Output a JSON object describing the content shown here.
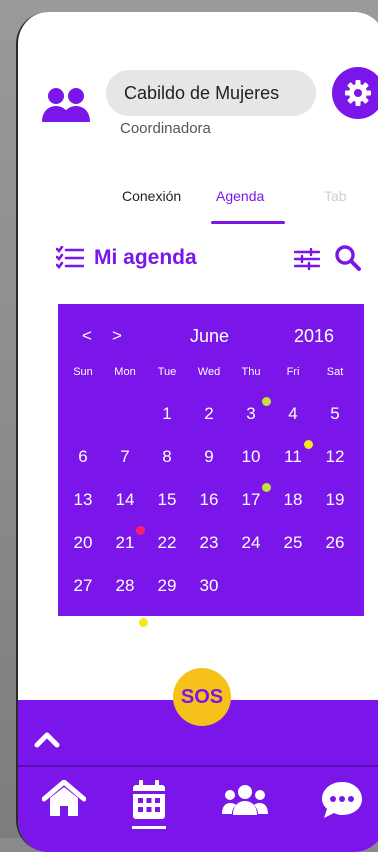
{
  "user": {
    "name": "Cabildo de Mujeres",
    "role": "Coordinadora"
  },
  "tabs": [
    {
      "label": "Conexión",
      "active": false
    },
    {
      "label": "Agenda",
      "active": true
    },
    {
      "label": "Tab",
      "active": false
    }
  ],
  "agenda": {
    "title": "Mi agenda"
  },
  "calendar": {
    "prev": "<",
    "next": ">",
    "month": "June",
    "year": "2016",
    "weekdays": [
      "Sun",
      "Mon",
      "Tue",
      "Wed",
      "Thu",
      "Fri",
      "Sat"
    ],
    "weeks": [
      [
        "",
        "",
        "1",
        "2",
        "3",
        "4",
        "5"
      ],
      [
        "6",
        "7",
        "8",
        "9",
        "10",
        "11",
        "12"
      ],
      [
        "13",
        "14",
        "15",
        "16",
        "17",
        "18",
        "19"
      ],
      [
        "20",
        "21",
        "22",
        "23",
        "24",
        "25",
        "26"
      ],
      [
        "27",
        "28",
        "29",
        "30",
        "",
        "",
        ""
      ]
    ],
    "event_dots": [
      {
        "day": "3",
        "color": "#c5e03a"
      },
      {
        "day": "11",
        "color": "#f6e61a"
      },
      {
        "day": "17",
        "color": "#c5e03a"
      },
      {
        "day": "21",
        "color": "#ff1e6e"
      }
    ]
  },
  "sos": {
    "label": "SOS"
  },
  "colors": {
    "accent": "#7a16ea",
    "sos": "#f6c21a"
  },
  "nav": {
    "items": [
      "home-icon",
      "calendar-icon",
      "users-icon",
      "chat-icon"
    ],
    "active": "calendar-icon"
  }
}
